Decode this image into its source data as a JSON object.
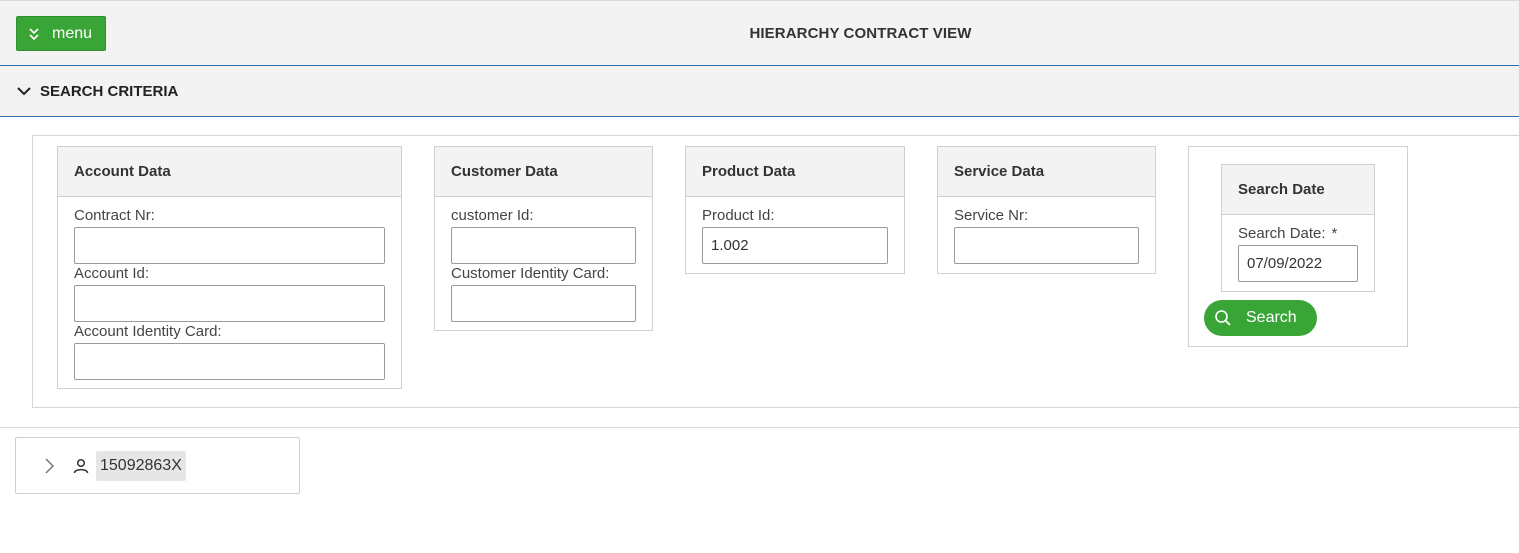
{
  "header": {
    "menu_label": "menu",
    "title": "HIERARCHY CONTRACT VIEW"
  },
  "search_criteria": {
    "title": "SEARCH CRITERIA",
    "account": {
      "title": "Account Data",
      "contract_nr_label": "Contract Nr:",
      "contract_nr_value": "",
      "account_id_label": "Account Id:",
      "account_id_value": "",
      "account_identity_label": "Account Identity Card:",
      "account_identity_value": ""
    },
    "customer": {
      "title": "Customer Data",
      "customer_id_label": "customer Id:",
      "customer_id_value": "",
      "customer_identity_label": "Customer Identity Card:",
      "customer_identity_value": ""
    },
    "product": {
      "title": "Product Data",
      "product_id_label": "Product Id:",
      "product_id_value": "1.002"
    },
    "service": {
      "title": "Service Data",
      "service_nr_label": "Service Nr:",
      "service_nr_value": ""
    },
    "search_date": {
      "title": "Search Date",
      "label": "Search Date:",
      "required_mark": "*",
      "value": "07/09/2022"
    },
    "search_button_label": "Search"
  },
  "tree": {
    "node_label": "15092863X"
  },
  "colors": {
    "accent_green": "#3aa537",
    "header_border_blue": "#2d6ea8",
    "panel_bg": "#f3f3f3"
  },
  "icons": {
    "menu": "double-chevron-down-icon",
    "criteria_toggle": "chevron-down-icon",
    "search": "search-icon",
    "tree_expand": "chevron-right-icon",
    "tree_node": "person-icon"
  }
}
